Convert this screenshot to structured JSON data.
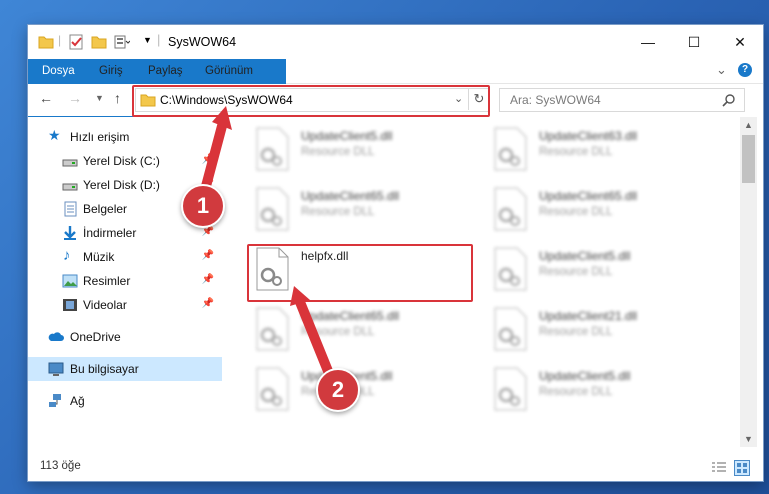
{
  "window": {
    "title": "SysWOW64",
    "minimize_glyph": "—",
    "maximize_glyph": "☐",
    "close_glyph": "✕"
  },
  "ribbon": {
    "tabs": [
      "Dosya",
      "Giriş",
      "Paylaş",
      "Görünüm"
    ],
    "help_glyph": "?",
    "collapse_glyph": "⌄"
  },
  "address": {
    "path": "C:\\Windows\\SysWOW64",
    "search_placeholder": "Ara: SysWOW64"
  },
  "nav": {
    "items": [
      {
        "label": "Hızlı erişim",
        "icon": "star-icon",
        "pinned": false
      },
      {
        "label": "Yerel Disk (C:)",
        "icon": "drive-icon",
        "pinned": true
      },
      {
        "label": "Yerel Disk (D:)",
        "icon": "drive-icon",
        "pinned": true
      },
      {
        "label": "Belgeler",
        "icon": "document-icon",
        "pinned": true
      },
      {
        "label": "İndirmeler",
        "icon": "download-icon",
        "pinned": true
      },
      {
        "label": "Müzik",
        "icon": "music-icon",
        "pinned": true
      },
      {
        "label": "Resimler",
        "icon": "pictures-icon",
        "pinned": true
      },
      {
        "label": "Videolar",
        "icon": "video-icon",
        "pinned": true
      },
      {
        "label": "OneDrive",
        "icon": "cloud-icon",
        "pinned": false
      },
      {
        "label": "Bu bilgisayar",
        "icon": "computer-icon",
        "pinned": false,
        "selected": true
      },
      {
        "label": "Ağ",
        "icon": "network-icon",
        "pinned": false
      }
    ]
  },
  "files": [
    {
      "name": "UpdateClient5.dll",
      "desc": "Resource DLL",
      "blurred": true
    },
    {
      "name": "UpdateClient63.dll",
      "desc": "Resource DLL",
      "blurred": true
    },
    {
      "name": "UpdateClient65.dll",
      "desc": "Resource DLL",
      "blurred": true
    },
    {
      "name": "UpdateClient65.dll",
      "desc": "Resource DLL",
      "blurred": true
    },
    {
      "name": "helpfx.dll",
      "desc": "",
      "blurred": false,
      "highlighted": true
    },
    {
      "name": "UpdateClient5.dll",
      "desc": "Resource DLL",
      "blurred": true
    },
    {
      "name": "UpdateClient65.dll",
      "desc": "Resource DLL",
      "blurred": true
    },
    {
      "name": "UpdateClient21.dll",
      "desc": "Resource DLL",
      "blurred": true
    },
    {
      "name": "UpdateClient5.dll",
      "desc": "Resource DLL",
      "blurred": true
    },
    {
      "name": "UpdateClient5.dll",
      "desc": "Resource DLL",
      "blurred": true
    }
  ],
  "status": {
    "item_count": "113 öğe"
  },
  "callouts": [
    "1",
    "2"
  ],
  "colors": {
    "accent": "#1979ca",
    "highlight": "#d9343a",
    "selection": "#cce8ff"
  }
}
